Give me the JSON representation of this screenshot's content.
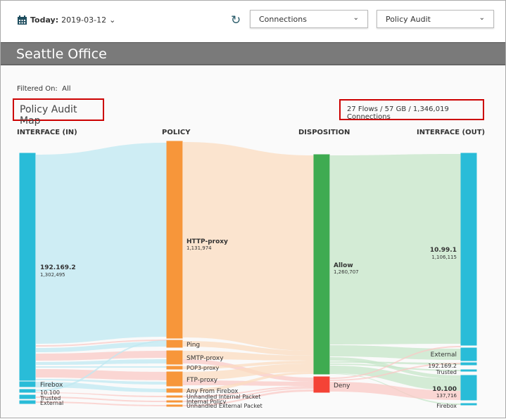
{
  "toolbar": {
    "date_label": "Today:",
    "date_value": "2019-03-12",
    "calendar_icon": "calendar-icon",
    "refresh_icon": "refresh-icon",
    "report_type": "Connections",
    "view": "Policy Audit"
  },
  "header": {
    "title": "Seattle Office"
  },
  "filter": {
    "label": "Filtered On:",
    "value": "All"
  },
  "map": {
    "title": "Policy Audit Map",
    "summary": "27 Flows / 57 GB / 1,346,019 Connections",
    "columns": [
      "INTERFACE (IN)",
      "POLICY",
      "DISPOSITION",
      "INTERFACE (OUT)"
    ],
    "colors": {
      "interface": "#29bcd8",
      "policy": "#f7963a",
      "allow": "#3fab51",
      "deny": "#f44336"
    },
    "interface_in": [
      {
        "name": "192.169.2",
        "value": "1,302,495"
      },
      {
        "name": "Firebox"
      },
      {
        "name": "10.100"
      },
      {
        "name": "Trusted"
      },
      {
        "name": "External"
      }
    ],
    "policy": [
      {
        "name": "HTTP-proxy",
        "value": "1,131,974"
      },
      {
        "name": "Ping"
      },
      {
        "name": "SMTP-proxy"
      },
      {
        "name": "POP3-proxy"
      },
      {
        "name": "FTP-proxy"
      },
      {
        "name": "Any From Firebox"
      },
      {
        "name": "Unhandled Internal Packet"
      },
      {
        "name": "Internal Policy"
      },
      {
        "name": "Unhandled External Packet"
      }
    ],
    "disposition": [
      {
        "name": "Allow",
        "value": "1,260,707"
      },
      {
        "name": "Deny"
      }
    ],
    "interface_out": [
      {
        "name": "10.99.1",
        "value": "1,106,115"
      },
      {
        "name": "External"
      },
      {
        "name": "192.169.2"
      },
      {
        "name": "Trusted"
      },
      {
        "name": "10.100",
        "value": "137,716"
      },
      {
        "name": "Firebox"
      }
    ]
  }
}
